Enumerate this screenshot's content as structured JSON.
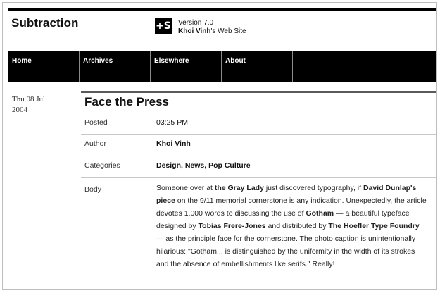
{
  "site": {
    "title": "Subtraction",
    "logo_glyph": "+S",
    "version": "Version 7.0",
    "owner": "Khoi Vinh",
    "owner_suffix": "'s Web Site"
  },
  "nav": {
    "items": [
      {
        "label": "Home"
      },
      {
        "label": "Archives"
      },
      {
        "label": "Elsewhere"
      },
      {
        "label": "About"
      }
    ]
  },
  "entry": {
    "date_line1": "Thu 08 Jul",
    "date_line2": "2004",
    "title": "Face the Press",
    "fields": {
      "posted_label": "Posted",
      "posted_value": "03:25 PM",
      "author_label": "Author",
      "author_value": "Khoi Vinh",
      "categories_label": "Categories",
      "categories_value": "Design, News, Pop Culture",
      "body_label": "Body"
    },
    "body": {
      "t1": "Someone over at ",
      "b1": "the Gray Lady",
      "t2": " just discovered typography, if ",
      "b2": "David Dunlap's piece",
      "t3": " on the 9/11 memorial cornerstone is any indication. Unexpectedly, the article devotes 1,000 words to discussing the use of ",
      "b3": "Gotham",
      "t4": " — a beautiful typeface designed by ",
      "b4": "Tobias Frere-Jones",
      "t5": " and distributed by ",
      "b5": "The Hoefler Type Foundry",
      "t6": " — as the principle face for the cornerstone. The photo caption is unintentionally hilarious: \"Gotham... is distinguished by the uniformity in the width of its strokes and the absence of embellishments like serifs.\" Really!"
    }
  }
}
